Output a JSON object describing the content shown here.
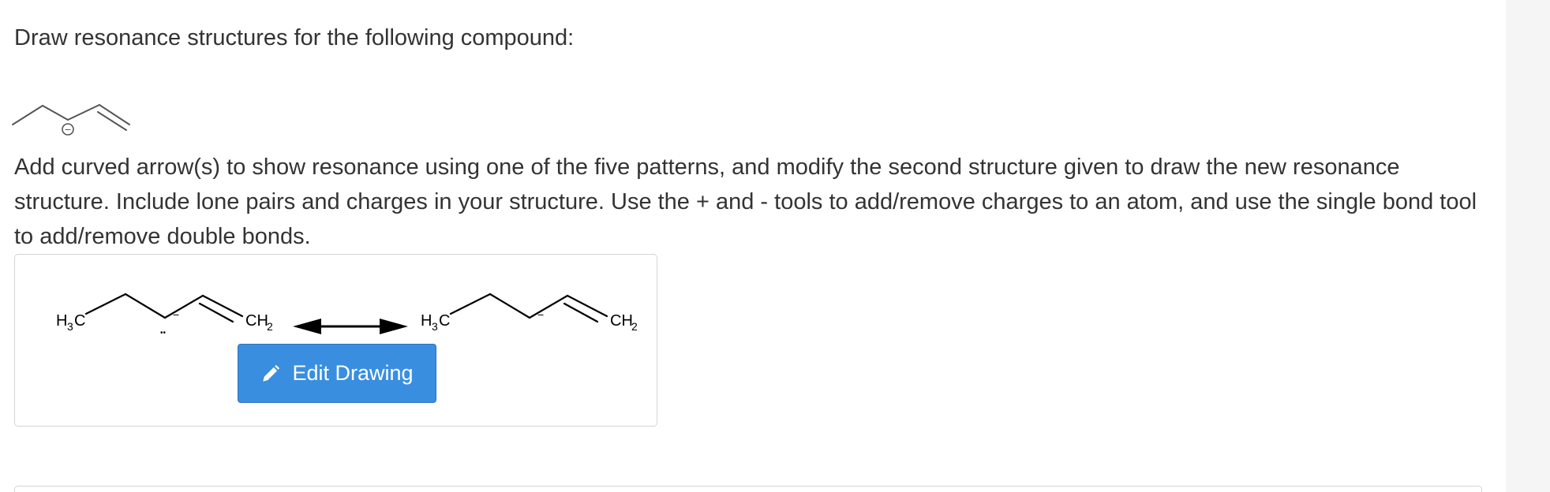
{
  "question": {
    "prompt": "Draw resonance structures for the following compound:",
    "instructions": "Add curved arrow(s) to show resonance using one of the five patterns, and modify the second structure given to draw the new resonance structure. Include lone pairs and charges in your structure. Use the + and - tools to add/remove charges to an atom, and use the single bond tool to add/remove double bonds."
  },
  "compound": {
    "charge_symbol": "−"
  },
  "drawing": {
    "left": {
      "start_label": "H",
      "start_sub": "3",
      "start_suffix": "C",
      "end_label": "CH",
      "end_sub": "2",
      "charge": "−",
      "lone_pair": "••"
    },
    "right": {
      "start_label": "H",
      "start_sub": "3",
      "start_suffix": "C",
      "end_label": "CH",
      "end_sub": "2",
      "charge": "−"
    },
    "edit_button_label": "Edit Drawing",
    "edit_icon": "pencil-icon"
  },
  "colors": {
    "button_bg": "#3a8ee0",
    "button_border": "#2d72bf",
    "text": "#333333"
  }
}
